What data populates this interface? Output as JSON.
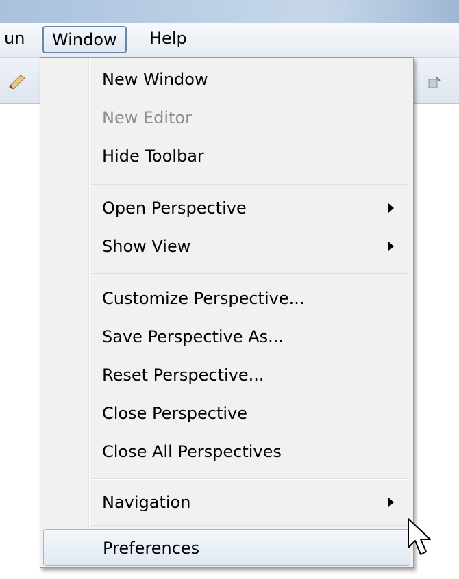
{
  "menubar": {
    "items": [
      {
        "label": "un"
      },
      {
        "label": "Window"
      },
      {
        "label": "Help"
      }
    ]
  },
  "window_menu": {
    "new_window": "New Window",
    "new_editor": "New Editor",
    "hide_toolbar": "Hide Toolbar",
    "open_perspective": "Open Perspective",
    "show_view": "Show View",
    "customize_perspective": "Customize Perspective...",
    "save_perspective_as": "Save Perspective As...",
    "reset_perspective": "Reset Perspective...",
    "close_perspective": "Close Perspective",
    "close_all_perspectives": "Close All Perspectives",
    "navigation": "Navigation",
    "preferences": "Preferences"
  },
  "icons": {
    "toolbar_left": "pencil-icon",
    "toolbar_right": "toolbar-icon",
    "submenu": "chevron-right-icon",
    "cursor": "mouse-pointer-icon"
  },
  "colors": {
    "highlight_border": "#9fb6d1",
    "disabled_text": "#8d8d8d",
    "menu_background": "#f1f1f1"
  }
}
